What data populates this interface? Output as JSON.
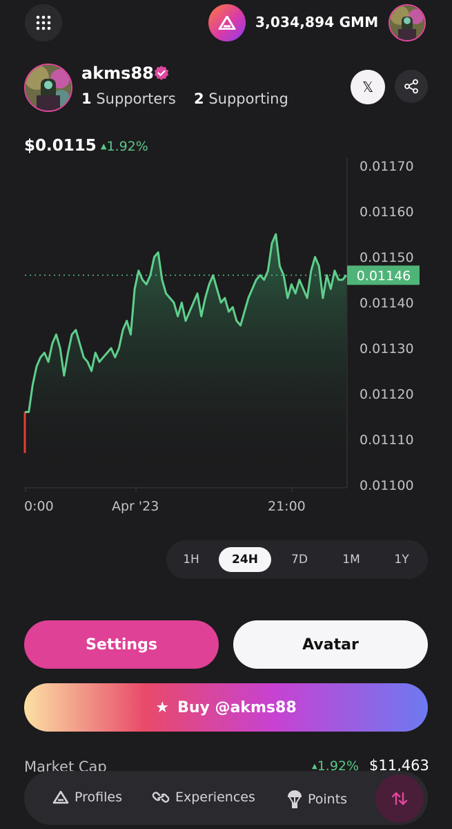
{
  "header": {
    "balance": "3,034,894 GMM"
  },
  "profile": {
    "username": "akms88",
    "supporters_count": "1",
    "supporters_label": "Supporters",
    "supporting_count": "2",
    "supporting_label": "Supporting",
    "x_label": "𝕏"
  },
  "price": {
    "value": "$0.0115",
    "change": "1.92%"
  },
  "chart_data": {
    "type": "area",
    "x_tick_labels": [
      "0:00",
      "Apr '23",
      "21:00"
    ],
    "y_tick_labels": [
      "0.01170",
      "0.01160",
      "0.01150",
      "0.01140",
      "0.01130",
      "0.01120",
      "0.01110",
      "0.01100"
    ],
    "ylim": [
      0.011,
      0.0117
    ],
    "current_value_label": "0.01146",
    "current_value": 0.01146,
    "series": [
      {
        "color": "#5fcf8c",
        "values": [
          0.01107,
          0.01116,
          0.01122,
          0.01126,
          0.01128,
          0.01129,
          0.01127,
          0.01131,
          0.01133,
          0.0113,
          0.01124,
          0.01129,
          0.01133,
          0.01134,
          0.01131,
          0.01128,
          0.01127,
          0.01125,
          0.01129,
          0.01127,
          0.01128,
          0.01129,
          0.0113,
          0.01128,
          0.0113,
          0.01134,
          0.01136,
          0.01133,
          0.01143,
          0.01147,
          0.01145,
          0.01144,
          0.01146,
          0.0115,
          0.01151,
          0.01145,
          0.01142,
          0.01141,
          0.0114,
          0.01137,
          0.0114,
          0.01136,
          0.01138,
          0.0114,
          0.01142,
          0.01137,
          0.01141,
          0.01144,
          0.01146,
          0.01143,
          0.0114,
          0.01141,
          0.01138,
          0.01139,
          0.01136,
          0.01135,
          0.01138,
          0.01141,
          0.01143,
          0.01145,
          0.01146,
          0.01145,
          0.01147,
          0.01153,
          0.01155,
          0.01148,
          0.01146,
          0.01141,
          0.01144,
          0.01142,
          0.01145,
          0.01143,
          0.01141,
          0.01147,
          0.0115,
          0.01148,
          0.01141,
          0.01146,
          0.01143,
          0.01147,
          0.01145,
          0.01145,
          0.01146
        ]
      }
    ],
    "grid": false,
    "baseline_dotted": true
  },
  "ranges": {
    "options": [
      "1H",
      "24H",
      "7D",
      "1M",
      "1Y"
    ],
    "selected": "24H"
  },
  "actions": {
    "settings_label": "Settings",
    "avatar_label": "Avatar",
    "buy_label": "Buy @akms88"
  },
  "stats": {
    "market_cap_label": "Market Cap",
    "market_cap_change": "1.92%",
    "market_cap_value": "$11,463"
  },
  "nav": {
    "profiles": "Profiles",
    "experiences": "Experiences",
    "points": "Points"
  },
  "colors": {
    "accent_pink": "#de4196",
    "positive_green": "#59c98a",
    "negative_red": "#e0402f"
  }
}
